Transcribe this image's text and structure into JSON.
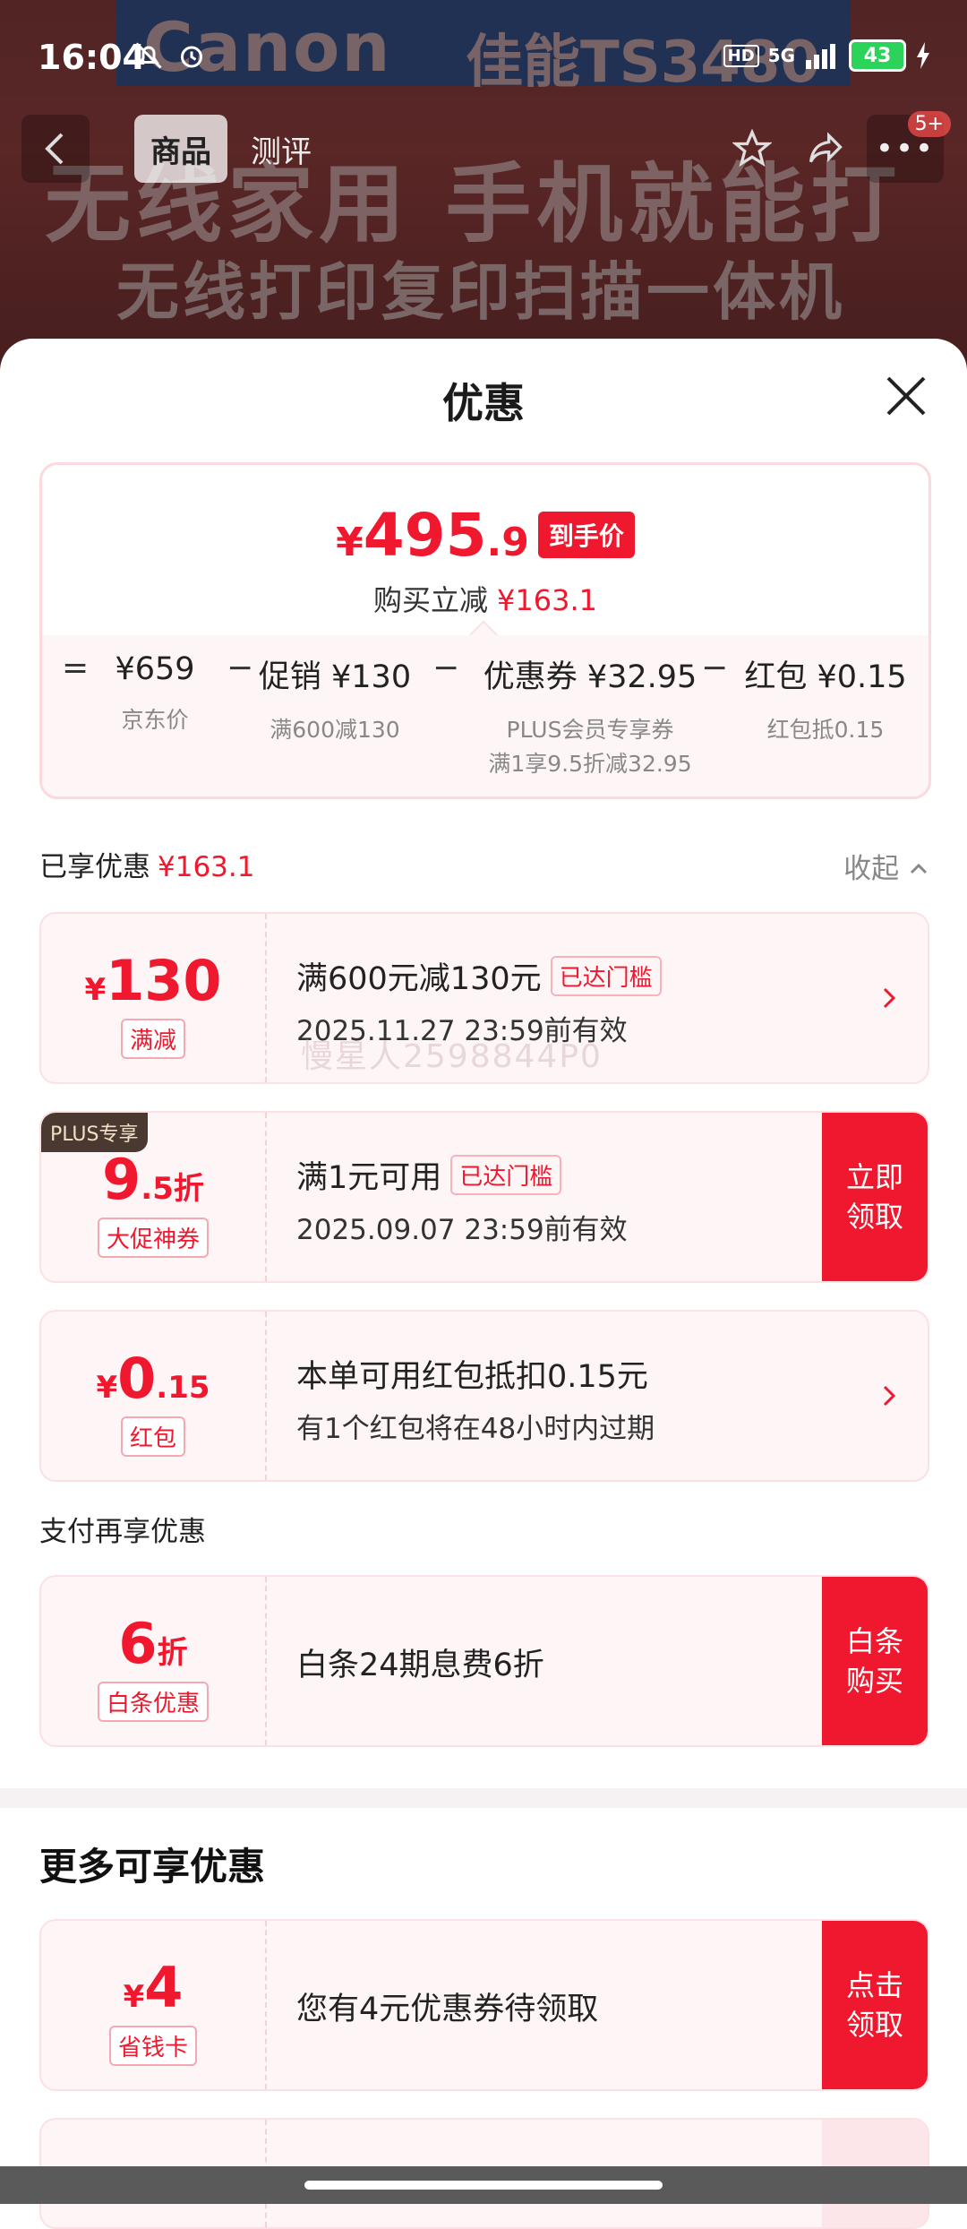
{
  "status": {
    "time": "16:04",
    "hd": "HD",
    "network": "5G",
    "battery": "43"
  },
  "hero": {
    "brand": "Canon",
    "model": "佳能TS3480",
    "slogan": "无线家用 手机就能打",
    "sub": "无线打印复印扫描一体机"
  },
  "nav": {
    "tab_goods": "商品",
    "tab_review": "测评",
    "badge": "5+"
  },
  "sheet": {
    "title": "优惠"
  },
  "summary": {
    "yen": "¥",
    "price_int": "495",
    "price_dec": ".9",
    "tag": "到手价",
    "reduce_label": "购买立减",
    "reduce_value": "¥163.1",
    "breakdown": [
      {
        "value": "¥659",
        "sub": "京东价",
        "sub2": ""
      },
      {
        "value": "促销 ¥130",
        "sub": "满600减130",
        "sub2": ""
      },
      {
        "value": "优惠券 ¥32.95",
        "sub": "PLUS会员专享券",
        "sub2": "满1享9.5折减32.95"
      },
      {
        "value": "红包 ¥0.15",
        "sub": "红包抵0.15",
        "sub2": ""
      }
    ],
    "ops": [
      "=",
      "−",
      "−",
      "−"
    ]
  },
  "enjoyed": {
    "label": "已享优惠",
    "value": "¥163.1",
    "collapse": "收起"
  },
  "cards": [
    {
      "yen": "¥",
      "num": "130",
      "dec": "",
      "lbl": "满减",
      "t1": "满600元减130元",
      "pill": "已达门槛",
      "t2": "2025.11.27 23:59前有效"
    },
    {
      "yen": "",
      "num": "9",
      "dec": ".5折",
      "lbl": "大促神券",
      "plus": "PLUS专享",
      "t1": "满1元可用",
      "pill": "已达门槛",
      "t2": "2025.09.07 23:59前有效",
      "cta": [
        "立即",
        "领取"
      ]
    },
    {
      "yen": "¥",
      "num": "0",
      "dec": ".15",
      "lbl": "红包",
      "t1": "本单可用红包抵扣0.15元",
      "t2": "有1个红包将在48小时内过期"
    }
  ],
  "pay_section": {
    "label": "支付再享优惠"
  },
  "pay_card": {
    "num": "6",
    "dec": "折",
    "lbl": "白条优惠",
    "t1": "白条24期息费6折",
    "cta": [
      "白条",
      "购买"
    ]
  },
  "watermark": "慢星人2598844P0",
  "more": {
    "title": "更多可享优惠"
  },
  "more_card": {
    "yen": "¥",
    "num": "4",
    "lbl": "省钱卡",
    "t1": "您有4元优惠券待领取",
    "cta": [
      "点击",
      "领取"
    ]
  }
}
